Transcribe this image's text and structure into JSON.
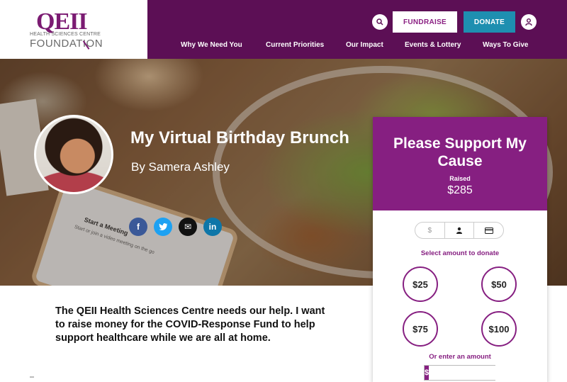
{
  "header": {
    "logo": {
      "main": "QEII",
      "line1": "HEALTH SCIENCES CENTRE",
      "line2": "FOUNDATION"
    },
    "fundraise_label": "FUNDRAISE",
    "donate_label": "DONATE",
    "search_icon": "search-icon",
    "user_icon": "user-icon",
    "nav": [
      "Why We Need You",
      "Current Priorities",
      "Our Impact",
      "Events & Lottery",
      "Ways To Give"
    ],
    "colors": {
      "bar": "#5c0f55",
      "donate": "#1e8fb0"
    }
  },
  "hero": {
    "title": "My Virtual Birthday Brunch",
    "author": "By Samera Ashley",
    "phone_title": "Start a Meeting",
    "phone_sub": "Start or join a video meeting on the go",
    "share": [
      {
        "icon": "facebook-icon",
        "glyph": "f"
      },
      {
        "icon": "twitter-icon",
        "glyph": "t"
      },
      {
        "icon": "email-icon",
        "glyph": "✉"
      },
      {
        "icon": "linkedin-icon",
        "glyph": "in"
      }
    ]
  },
  "story": "The QEII Health Sciences Centre needs our help. I want to raise money for the COVID-Response Fund to help support healthcare while we are all at home.",
  "panel": {
    "title": "Please Support My Cause",
    "raised_label": "Raised",
    "raised_amount": "$285",
    "steps": [
      {
        "icon": "dollar-icon",
        "glyph": "$"
      },
      {
        "icon": "person-icon",
        "glyph": "👤"
      },
      {
        "icon": "credit-card-icon",
        "glyph": "▭"
      }
    ],
    "select_label": "Select amount to donate",
    "amounts": [
      "$25",
      "$50",
      "$75",
      "$100"
    ],
    "enter_label": "Or enter an amount",
    "amount_prefix": "$",
    "amount_value": "",
    "color": "#861f81"
  }
}
